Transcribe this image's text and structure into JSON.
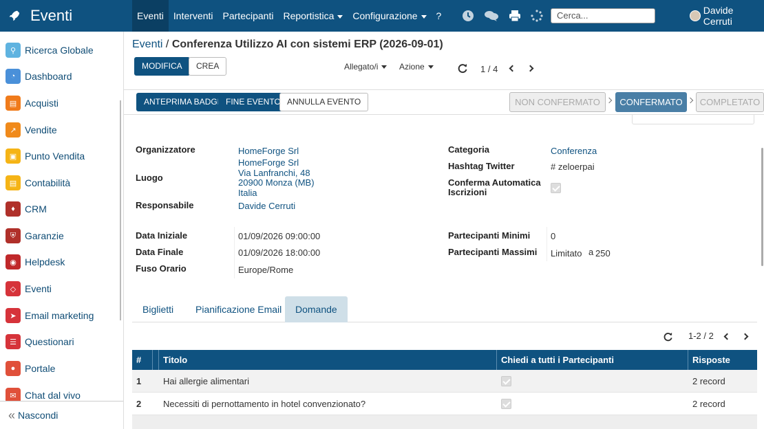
{
  "app": {
    "title": "Eventi"
  },
  "topnav": {
    "items": [
      {
        "label": "Eventi",
        "active": true,
        "dropdown": false
      },
      {
        "label": "Interventi",
        "active": false,
        "dropdown": false
      },
      {
        "label": "Partecipanti",
        "active": false,
        "dropdown": false
      },
      {
        "label": "Reportistica",
        "active": false,
        "dropdown": true
      },
      {
        "label": "Configurazione",
        "active": false,
        "dropdown": true
      },
      {
        "label": "?",
        "active": false,
        "dropdown": false
      }
    ],
    "icons": [
      "clock-icon",
      "chat-icon",
      "printer-icon",
      "spinner-icon"
    ],
    "search_placeholder": "Cerca...",
    "user_name": "Davide Cerruti"
  },
  "sidebar": {
    "items": [
      {
        "label": "Ricerca Globale",
        "icon": "search-icon",
        "color": "#5fb3e0"
      },
      {
        "label": "Dashboard",
        "icon": "dashboard-icon",
        "color": "#4a90d9"
      },
      {
        "label": "Acquisti",
        "icon": "card-icon",
        "color": "#f07b1b"
      },
      {
        "label": "Vendite",
        "icon": "chart-icon",
        "color": "#f08a1b"
      },
      {
        "label": "Punto Vendita",
        "icon": "pos-icon",
        "color": "#f5b416"
      },
      {
        "label": "Contabilità",
        "icon": "document-icon",
        "color": "#f5b416"
      },
      {
        "label": "CRM",
        "icon": "handshake-icon",
        "color": "#b0302a"
      },
      {
        "label": "Garanzie",
        "icon": "shield-icon",
        "color": "#b0302a"
      },
      {
        "label": "Helpdesk",
        "icon": "headset-icon",
        "color": "#c0282a"
      },
      {
        "label": "Eventi",
        "icon": "ticket-icon",
        "color": "#d6333a"
      },
      {
        "label": "Email marketing",
        "icon": "paper-plane-icon",
        "color": "#d6333a"
      },
      {
        "label": "Questionari",
        "icon": "survey-icon",
        "color": "#d6333a"
      },
      {
        "label": "Portale",
        "icon": "globe-icon",
        "color": "#e0503a"
      },
      {
        "label": "Chat dal vivo",
        "icon": "chat-bubble-icon",
        "color": "#e0503a"
      }
    ],
    "footer_label": "Nascondi"
  },
  "breadcrumb": {
    "parent": "Eventi",
    "separator": "/",
    "current": "Conferenza Utilizzo AI con sistemi ERP (2026-09-01)"
  },
  "controls": {
    "edit_label": "MODIFICA",
    "create_label": "CREA",
    "attachment_label": "Allegato/i",
    "action_label": "Azione",
    "pager": "1 / 4"
  },
  "header_buttons": {
    "badge_preview": "ANTEPRIMA BADGE",
    "end_event": "FINE EVENTO",
    "cancel_event": "ANNULLA EVENTO"
  },
  "stages": [
    {
      "label": "NON CONFERMATO",
      "state": "inactive"
    },
    {
      "label": "CONFERMATO",
      "state": "active"
    },
    {
      "label": "COMPLETATO",
      "state": "inactive"
    }
  ],
  "form": {
    "organizer_label": "Organizzatore",
    "organizer_value": "HomeForge Srl",
    "venue_label": "Luogo",
    "venue_lines": [
      "HomeForge Srl",
      "Via Lanfranchi, 48",
      "20900 Monza (MB)",
      "Italia"
    ],
    "responsible_label": "Responsabile",
    "responsible_value": "Davide Cerruti",
    "category_label": "Categoria",
    "category_value": "Conferenza",
    "hashtag_label": "Hashtag Twitter",
    "hashtag_prefix": "#",
    "hashtag_value": "zeloerpai",
    "autoconfirm_label_1": "Conferma Automatica",
    "autoconfirm_label_2": "Iscrizioni",
    "autoconfirm_checked": true,
    "start_label": "Data Iniziale",
    "start_value": "01/09/2026 09:00:00",
    "end_label": "Data Finale",
    "end_value": "01/09/2026 18:00:00",
    "tz_label": "Fuso Orario",
    "tz_value": "Europe/Rome",
    "min_label": "Partecipanti Minimi",
    "min_value": "0",
    "max_label": "Partecipanti Massimi",
    "max_mode": "Limitato",
    "max_connector": "a",
    "max_value": "250"
  },
  "tabs": [
    {
      "label": "Biglietti",
      "active": false
    },
    {
      "label": "Pianificazione Email",
      "active": false
    },
    {
      "label": "Domande",
      "active": true
    }
  ],
  "list_pager": "1-2 / 2",
  "table": {
    "headers": [
      "#",
      "Titolo",
      "Chiedi a tutti i Partecipanti",
      "Risposte"
    ],
    "rows": [
      {
        "num": "1",
        "title": "Hai allergie alimentari",
        "ask_all": true,
        "answers": "2 record"
      },
      {
        "num": "2",
        "title": "Necessiti di pernottamento in hotel convenzionato?",
        "ask_all": true,
        "answers": "2 record"
      }
    ]
  }
}
